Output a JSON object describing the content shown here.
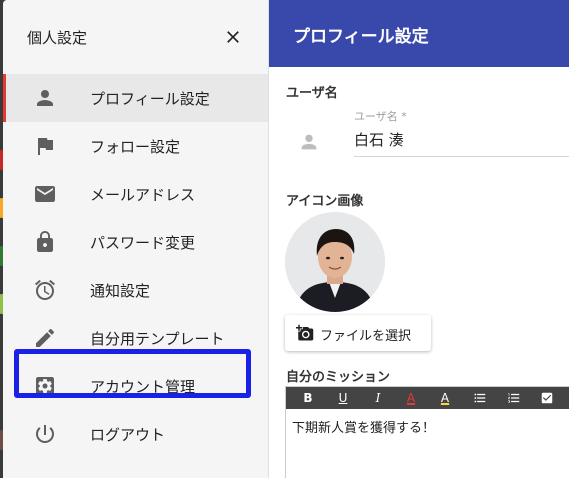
{
  "drawer": {
    "title": "個人設定",
    "items": [
      {
        "label": "プロフィール設定",
        "icon": "person-icon",
        "active": true
      },
      {
        "label": "フォロー設定",
        "icon": "flag-icon"
      },
      {
        "label": "メールアドレス",
        "icon": "mail-icon"
      },
      {
        "label": "パスワード変更",
        "icon": "lock-icon"
      },
      {
        "label": "通知設定",
        "icon": "alarm-icon"
      },
      {
        "label": "自分用テンプレート",
        "icon": "pencil-icon"
      },
      {
        "label": "アカウント管理",
        "icon": "gear-icon",
        "highlighted": true
      },
      {
        "label": "ログアウト",
        "icon": "power-icon"
      }
    ]
  },
  "panel": {
    "title": "プロフィール設定",
    "username_section": "ユーザ名",
    "username_field": {
      "label": "ユーザ名 *",
      "value": "白石 湊"
    },
    "icon_section": "アイコン画像",
    "file_button_label": "ファイルを選択",
    "mission_section": "自分のミッション",
    "editor_toolbar": [
      "B",
      "U",
      "I",
      "A",
      "A"
    ],
    "mission_text": "下期新人賞を獲得する！"
  },
  "colors": {
    "header": "#3949ab",
    "active_indicator": "#e53935",
    "highlight_box": "#1a22e8",
    "drawer_bg": "#f5f5f5",
    "toolbar_bg": "#444444"
  }
}
